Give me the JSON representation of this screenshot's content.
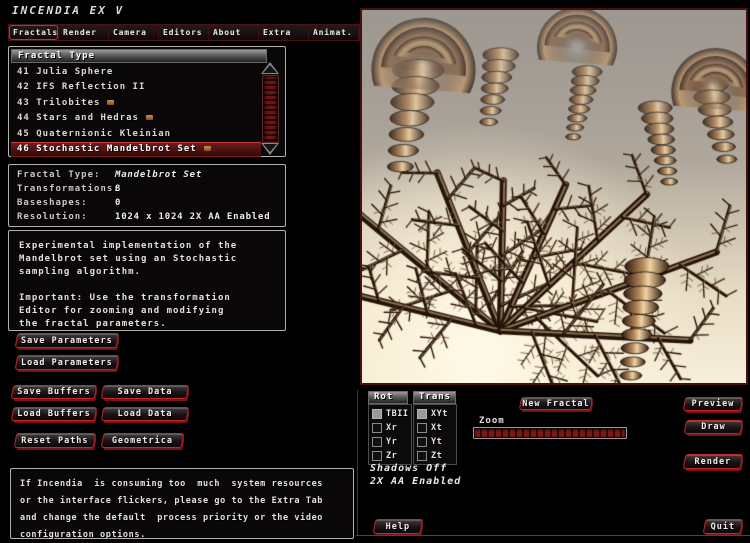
{
  "window": {
    "title": "INCENDIA EX V"
  },
  "menu": {
    "items": [
      {
        "label": "Fractals",
        "active": true
      },
      {
        "label": "Render",
        "active": false
      },
      {
        "label": "Camera",
        "active": false
      },
      {
        "label": "Editors",
        "active": false
      },
      {
        "label": "About",
        "active": false
      },
      {
        "label": "Extra",
        "active": false
      },
      {
        "label": "Animat.",
        "active": false
      }
    ]
  },
  "fractal_list": {
    "header": "Fractal Type",
    "items": [
      {
        "num": "41",
        "label": "Julia Sphere",
        "marker": false,
        "selected": false
      },
      {
        "num": "42",
        "label": "IFS Reflection II",
        "marker": false,
        "selected": false
      },
      {
        "num": "43",
        "label": "Trilobites",
        "marker": true,
        "selected": false
      },
      {
        "num": "44",
        "label": "Stars and Hedras",
        "marker": true,
        "selected": false
      },
      {
        "num": "45",
        "label": "Quaternionic Kleinian",
        "marker": false,
        "selected": false
      },
      {
        "num": "46",
        "label": "Stochastic Mandelbrot Set",
        "marker": true,
        "selected": true
      }
    ]
  },
  "info": {
    "rows": [
      {
        "label": "Fractal Type:",
        "value": "Mandelbrot Set",
        "italic": true
      },
      {
        "label": "Transformations:",
        "value": "8",
        "italic": false
      },
      {
        "label": "Baseshapes:",
        "value": "0",
        "italic": false
      },
      {
        "label": "Resolution:",
        "value": "1024 x 1024  2X AA Enabled",
        "italic": false
      }
    ]
  },
  "description": {
    "lines": [
      "Experimental implementation of the",
      "Mandelbrot set using an Stochastic",
      "sampling algorithm.",
      "",
      "Important: Use the transformation",
      "Editor for zooming and modifying",
      "the fractal parameters."
    ]
  },
  "warning": {
    "lines": [
      "If Incendia  is consuming too  much  system resources",
      "or the interface flickers, please go to the Extra Tab",
      "and change the default  process priority or the video",
      "configuration options."
    ]
  },
  "buttons": {
    "save_parameters": "Save Parameters",
    "load_parameters": "Load Parameters",
    "save_buffers": "Save Buffers",
    "save_data": "Save Data",
    "load_buffers": "Load Buffers",
    "load_data": "Load Data",
    "reset_paths": "Reset Paths",
    "geometrica": "Geometrica",
    "new_fractal": "New Fractal",
    "preview": "Preview",
    "draw": "Draw",
    "render": "Render",
    "help": "Help",
    "quit": "Quit"
  },
  "controls": {
    "rot": {
      "header": "Rot",
      "items": [
        {
          "label": "TBII",
          "checked": true
        },
        {
          "label": "Xr",
          "checked": false
        },
        {
          "label": "Yr",
          "checked": false
        },
        {
          "label": "Zr",
          "checked": false
        }
      ]
    },
    "trans": {
      "header": "Trans",
      "items": [
        {
          "label": "XYt",
          "checked": true
        },
        {
          "label": "Xt",
          "checked": false
        },
        {
          "label": "Yt",
          "checked": false
        },
        {
          "label": "Zt",
          "checked": false
        }
      ]
    },
    "zoom_label": "Zoom",
    "status": [
      "Shadows Off",
      "2X AA Enabled"
    ]
  },
  "viewport": {
    "alt": "3D stochastic Mandelbrot fractal render, bronze shells over cream glow"
  },
  "colors": {
    "accent_red": "#c42828",
    "panel_border": "#b5b2ae",
    "background": "#000000",
    "highlight_row": "#6e1c1c",
    "bronze": "#8a5f42"
  }
}
